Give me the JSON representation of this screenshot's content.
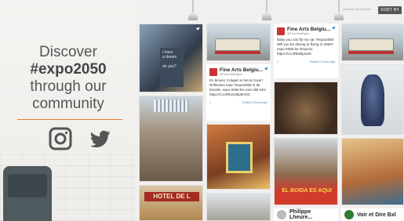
{
  "promo": {
    "line1": "Discover",
    "hashtag": "#expo2050",
    "line3": "through our",
    "line4": "community",
    "social": [
      "instagram-icon",
      "twitter-icon"
    ],
    "accent_color": "#e87d2f"
  },
  "toolbar": {
    "sort_label": "SORT BY",
    "powered_label": "powered by Flockler"
  },
  "tweets": [
    {
      "user": "Fine Arts Belgiu...",
      "handle": "@FineArtsBelgium",
      "text": "Baby you can fly my car. #expo2050 Will you be driving or flying in 2050? expo-2050.be #expo11 https://t.co/Rk69jJxUK",
      "likes": "1",
      "posted": "Posted 11 hours ago"
    },
    {
      "user": "Fine Arts Belgiu...",
      "handle": "@FineArtsBelgium",
      "text": "En binnen 3 dagen is het al zover! Reflecties naar #expo2050 in de bezalis. expo-2050.be voor alle info! https://t.co/RtoO3kp8AOC",
      "likes": "1",
      "posted": "Posted 13 hours ago"
    }
  ],
  "bottom_cards": [
    {
      "user": "Philippe Lheure..."
    },
    {
      "user": "Voir et Dire Bxl"
    }
  ],
  "photo_labels": {
    "hotel_sign": "HOTEL DE L",
    "mural_text": "EL BOIDA ES AQUI"
  }
}
